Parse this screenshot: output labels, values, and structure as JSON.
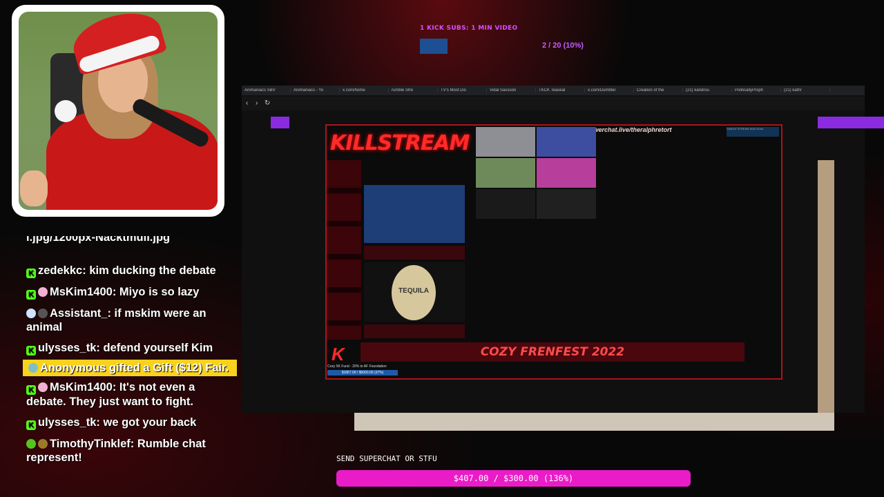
{
  "banner": {
    "text": "1 KICK SUBS: 1 MIN VIDEO",
    "progress": "2 / 20 (10%)"
  },
  "browser": {
    "tabs": [
      "Animaniacs SBV",
      "Animaniacs - Yo",
      "x.com/home",
      "rumble Stre",
      "TV's Most Dis",
      "Vidal Sassoon",
      "TKCK Teaseal",
      "x.com/Dumbtel",
      "Creation of the",
      "(21) kandrou",
      "PoliticallyProph",
      "(21) kathr"
    ],
    "nav": {
      "back": "‹",
      "forward": "›",
      "reload": "↻"
    }
  },
  "stream": {
    "logo": "KILLSTREAM",
    "tts": "TTS: powerchat.live/theralphretort",
    "sub_goal": "SINGLE STREAM SUB GOAL",
    "banner": "COZY FRENFEST 2022",
    "fund_label": "Cozy 5K Fund - 20% to AF Foundation",
    "fund_value": "$1867.00 / $5000.00 (37%)",
    "tequila": "TEQUILA"
  },
  "chat": {
    "cut_line": "l.jpg/1200px-Nacktmull.jpg",
    "messages": [
      {
        "user": "zedekkc",
        "text": "kim ducking the debate"
      },
      {
        "user": "MsKim1400",
        "text": "Miyo is so lazy"
      },
      {
        "user": "Assistant_",
        "text": "if mskim were an animal"
      },
      {
        "user": "ulysses_tk",
        "text": "defend yourself Kim"
      },
      {
        "user": "Anonymous",
        "text": "gifted a Gift ($12) Fair."
      },
      {
        "user": "MsKim1400",
        "text": "It's not even a debate. They just want to fight."
      },
      {
        "user": "ulysses_tk",
        "text": "we got your back"
      },
      {
        "user": "TimothyTinklef",
        "text": "Rumble chat represent!"
      }
    ]
  },
  "superchat": {
    "label": "SEND SUPERCHAT OR STFU",
    "progress": "$407.00 / $300.00 (136%)"
  },
  "colors": {
    "accent_pink": "#ea1cc8",
    "highlight": "#f8d21c",
    "kick_green": "#53fc18"
  }
}
